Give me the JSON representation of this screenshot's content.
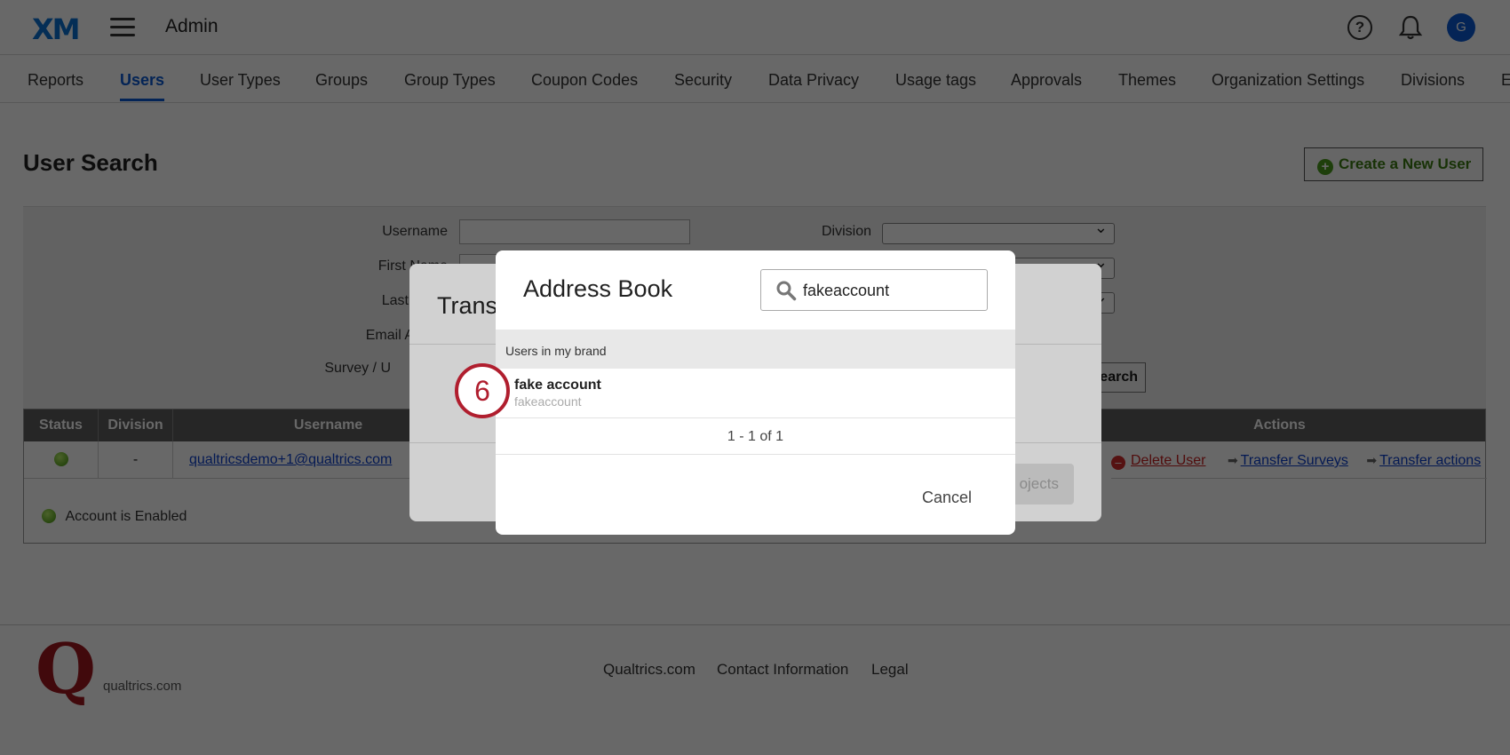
{
  "header": {
    "logo": "XM",
    "title": "Admin",
    "help_glyph": "?",
    "avatar_initial": "G"
  },
  "tabs": [
    {
      "label": "Reports",
      "active": false
    },
    {
      "label": "Users",
      "active": true
    },
    {
      "label": "User Types",
      "active": false
    },
    {
      "label": "Groups",
      "active": false
    },
    {
      "label": "Group Types",
      "active": false
    },
    {
      "label": "Coupon Codes",
      "active": false
    },
    {
      "label": "Security",
      "active": false
    },
    {
      "label": "Data Privacy",
      "active": false
    },
    {
      "label": "Usage tags",
      "active": false
    },
    {
      "label": "Approvals",
      "active": false
    },
    {
      "label": "Themes",
      "active": false
    },
    {
      "label": "Organization Settings",
      "active": false
    },
    {
      "label": "Divisions",
      "active": false
    },
    {
      "label": "E",
      "active": false
    }
  ],
  "page": {
    "title": "User Search",
    "create_button": "Create a New User"
  },
  "search_form": {
    "username_label": "Username",
    "first_name_label": "First Name",
    "last_name_label": "Last",
    "email_label": "Email A",
    "survey_label": "Survey / U",
    "division_label": "Division",
    "search_button": "earch"
  },
  "results": {
    "headers": {
      "status": "Status",
      "division": "Division",
      "username": "Username",
      "actions": "Actions"
    },
    "row": {
      "division": "-",
      "username": "qualtricsdemo+1@qualtrics.com",
      "delete": "Delete User",
      "transfer_surveys": "Transfer Surveys",
      "transfer_actions": "Transfer actions"
    },
    "legend": "Account is Enabled"
  },
  "footer": {
    "logo_text": "qualtrics.com",
    "links": [
      "Qualtrics.com",
      "Contact Information",
      "Legal"
    ]
  },
  "transfer_dialog": {
    "title": "Trans",
    "button": "ojects"
  },
  "address_book": {
    "title": "Address Book",
    "search_value": "fakeaccount",
    "section": "Users in my brand",
    "result_name": "fake account",
    "result_username": "fakeaccount",
    "pagination": "1 - 1 of 1",
    "cancel": "Cancel"
  },
  "step_badge": "6",
  "colors": {
    "accent": "#0b5bd3",
    "brand_red": "#b01e2e",
    "success_green": "#3c7d12",
    "delete_red": "#d12c2c"
  }
}
